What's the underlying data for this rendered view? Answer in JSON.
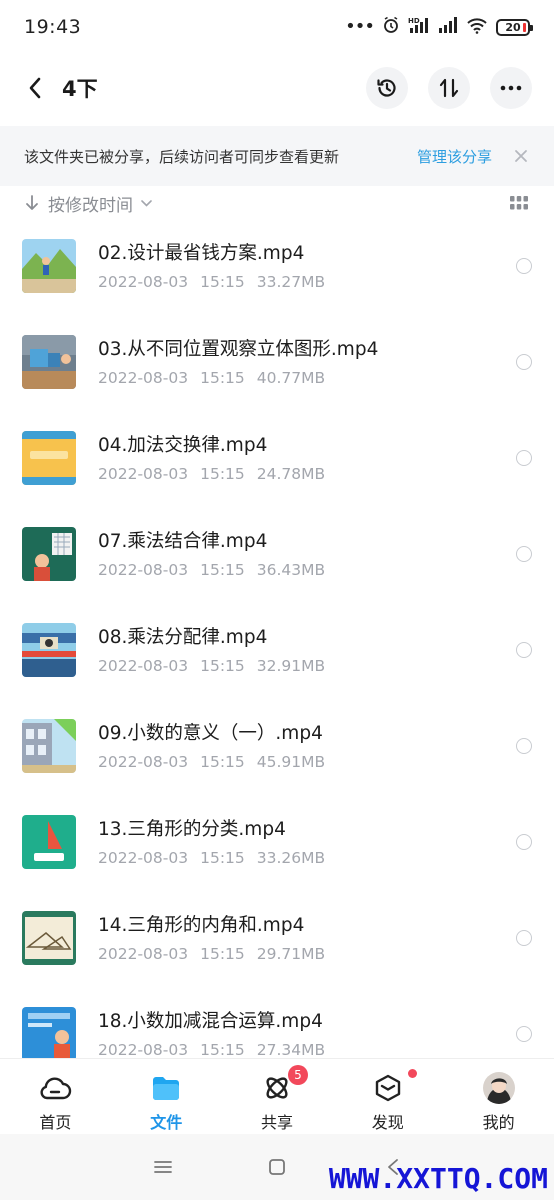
{
  "status_bar": {
    "time": "19:43",
    "battery": "20",
    "icons": [
      "more-dots-icon",
      "alarm-icon",
      "hd-signal-icon",
      "signal-icon",
      "wifi-icon",
      "battery-icon"
    ]
  },
  "header": {
    "title": "4下"
  },
  "share_banner": {
    "text": "该文件夹已被分享，后续访问者可同步查看更新",
    "action": "管理该分享"
  },
  "sort": {
    "label": "按修改时间"
  },
  "files": [
    {
      "name": "02.设计最省钱方案.mp4",
      "date": "2022-08-03",
      "time": "15:15",
      "size": "33.27MB",
      "thumb": "hill-scene"
    },
    {
      "name": "03.从不同位置观察立体图形.mp4",
      "date": "2022-08-03",
      "time": "15:15",
      "size": "40.77MB",
      "thumb": "classroom-blocks"
    },
    {
      "name": "04.加法交换律.mp4",
      "date": "2022-08-03",
      "time": "15:15",
      "size": "24.78MB",
      "thumb": "yellow-board"
    },
    {
      "name": "07.乘法结合律.mp4",
      "date": "2022-08-03",
      "time": "15:15",
      "size": "36.43MB",
      "thumb": "green-board"
    },
    {
      "name": "08.乘法分配律.mp4",
      "date": "2022-08-03",
      "time": "15:15",
      "size": "32.91MB",
      "thumb": "stage-scene"
    },
    {
      "name": "09.小数的意义（一）.mp4",
      "date": "2022-08-03",
      "time": "15:15",
      "size": "45.91MB",
      "thumb": "building-scene"
    },
    {
      "name": "13.三角形的分类.mp4",
      "date": "2022-08-03",
      "time": "15:15",
      "size": "33.26MB",
      "thumb": "triangle-card"
    },
    {
      "name": "14.三角形的内角和.mp4",
      "date": "2022-08-03",
      "time": "15:15",
      "size": "29.71MB",
      "thumb": "triangle-board"
    },
    {
      "name": "18.小数加减混合运算.mp4",
      "date": "2022-08-03",
      "time": "15:15",
      "size": "27.34MB",
      "thumb": "blue-board"
    }
  ],
  "nav": {
    "items": [
      {
        "label": "首页",
        "icon": "cloud-icon"
      },
      {
        "label": "文件",
        "icon": "folder-icon",
        "active": true
      },
      {
        "label": "共享",
        "icon": "atom-icon",
        "badge": "5"
      },
      {
        "label": "发现",
        "icon": "cube-icon",
        "dot": true
      },
      {
        "label": "我的",
        "icon": "avatar-icon"
      }
    ]
  },
  "watermark": "WWW.XXTTQ.COM",
  "colors": {
    "accent": "#1f95e8",
    "link": "#2d9ee0",
    "badge": "#f2485b",
    "meta_text": "#a3a6ad"
  }
}
